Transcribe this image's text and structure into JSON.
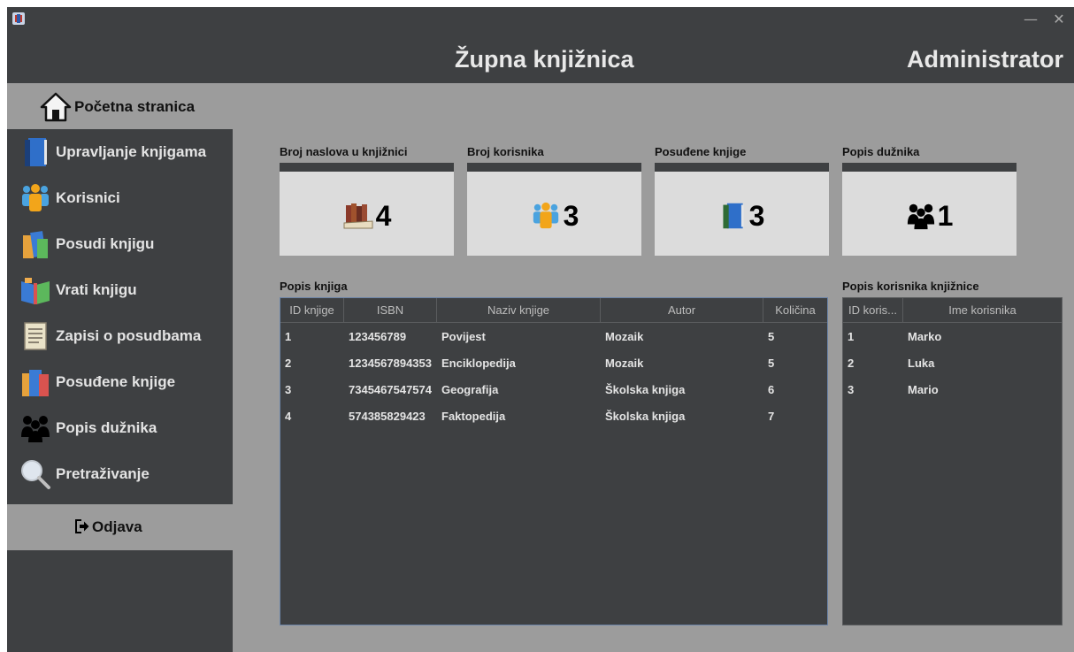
{
  "window": {
    "minimize": "—",
    "close": "✕"
  },
  "header": {
    "title": "Župna knjižnica",
    "user": "Administrator"
  },
  "sidebar": {
    "home": {
      "label": "Početna stranica",
      "icon": "home-icon"
    },
    "items": [
      {
        "label": "Upravljanje knjigama",
        "icon": "book-icon"
      },
      {
        "label": "Korisnici",
        "icon": "users-icon"
      },
      {
        "label": "Posudi knjigu",
        "icon": "books-icon"
      },
      {
        "label": "Vrati knjigu",
        "icon": "open-book-icon"
      },
      {
        "label": "Zapisi o posudbama",
        "icon": "records-icon"
      },
      {
        "label": "Posuđene knjige",
        "icon": "borrowed-books-icon"
      },
      {
        "label": "Popis dužnika",
        "icon": "group-icon"
      },
      {
        "label": "Pretraživanje",
        "icon": "magnifier-icon"
      }
    ],
    "logout": {
      "label": "Odjava",
      "icon": "logout-icon"
    }
  },
  "stats": [
    {
      "label": "Broj naslova u knjižnici",
      "value": "4",
      "icon": "library-books-icon"
    },
    {
      "label": "Broj korisnika",
      "value": "3",
      "icon": "users-icon"
    },
    {
      "label": "Posuđene knjige",
      "value": "3",
      "icon": "book-icon"
    },
    {
      "label": "Popis dužnika",
      "value": "1",
      "icon": "group-icon"
    }
  ],
  "books_table": {
    "title": "Popis knjiga",
    "columns": [
      "ID knjige",
      "ISBN",
      "Naziv knjige",
      "Autor",
      "Količina"
    ],
    "rows": [
      [
        "1",
        "123456789",
        "Povijest",
        "Mozaik",
        "5"
      ],
      [
        "2",
        "1234567894353",
        "Enciklopedija",
        "Mozaik",
        "5"
      ],
      [
        "3",
        "7345467547574",
        "Geografija",
        "Školska knjiga",
        "6"
      ],
      [
        "4",
        "574385829423",
        "Faktopedija",
        "Školska knjiga",
        "7"
      ]
    ]
  },
  "users_table": {
    "title": "Popis korisnika knjižnice",
    "columns": [
      "ID koris...",
      "Ime korisnika"
    ],
    "rows": [
      [
        "1",
        "Marko"
      ],
      [
        "2",
        "Luka"
      ],
      [
        "3",
        "Mario"
      ]
    ]
  },
  "colors": {
    "dark": "#3e4042",
    "background": "#9c9c9c",
    "card": "#dcdcdc",
    "table_border": "#6b84a8"
  }
}
